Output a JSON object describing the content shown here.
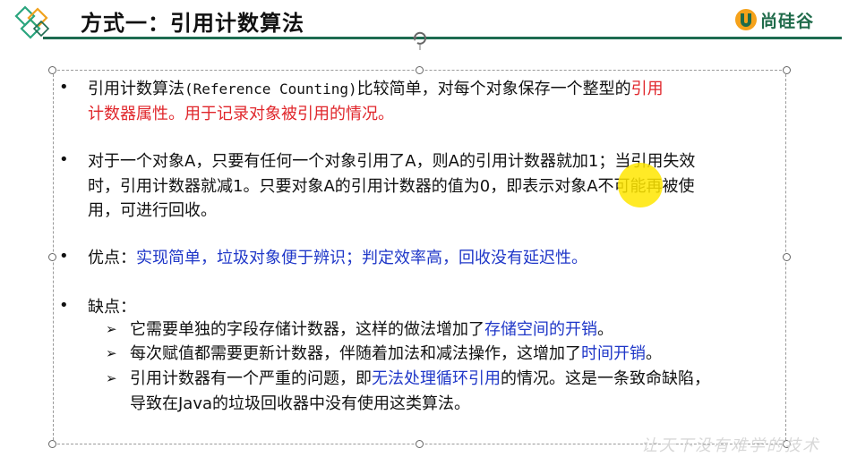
{
  "header": {
    "title": "方式一：引用计数算法",
    "brand_name": "尚硅谷",
    "brand_color": "#1f6b4a",
    "rule_color": "#1d6b50"
  },
  "content": {
    "p1": {
      "bullet": "•",
      "line1_a": "引用计数算法",
      "line1_code": "(Reference Counting)",
      "line1_b": "比较简单，对每个对象保存一个整型的",
      "line1_red": "引用",
      "line2_red": "计数器属性。用于记录对象被引用的情况。"
    },
    "p2": {
      "bullet": "•",
      "line1": "对于一个对象A，只要有任何一个对象引用了A，则A的引用计数器就加1；当引用失效",
      "line2": "时，引用计数器就减1。只要对象A的引用计数器的值为0，即表示对象A不可能再被使",
      "line3": "用，可进行回收。"
    },
    "p3": {
      "bullet": "•",
      "label": "优点：",
      "blue": "实现简单，垃圾对象便于辨识；判定效率高，回收没有延迟性。"
    },
    "p4": {
      "bullet": "•",
      "label": "缺点：",
      "items": [
        {
          "marker": "➢",
          "text": "它需要单独的字段存储计数器，这样的做法增加了",
          "blue": "存储空间的开销",
          "after": "。"
        },
        {
          "marker": "➢",
          "text": "每次赋值都需要更新计数器，伴随着加法和减法操作，这增加了",
          "blue": "时间开销",
          "after": "。"
        },
        {
          "marker": "➢",
          "text": "引用计数器有一个严重的问题，即",
          "blue": "无法处理循环引用",
          "after": "的情况。这是一条致命缺陷，",
          "line2": "导致在Java的垃圾回收器中没有使用这类算法。"
        }
      ]
    },
    "accent_red": "#e0262b",
    "accent_blue": "#1f37c8"
  },
  "watermark": "让天下没有难学的技术"
}
